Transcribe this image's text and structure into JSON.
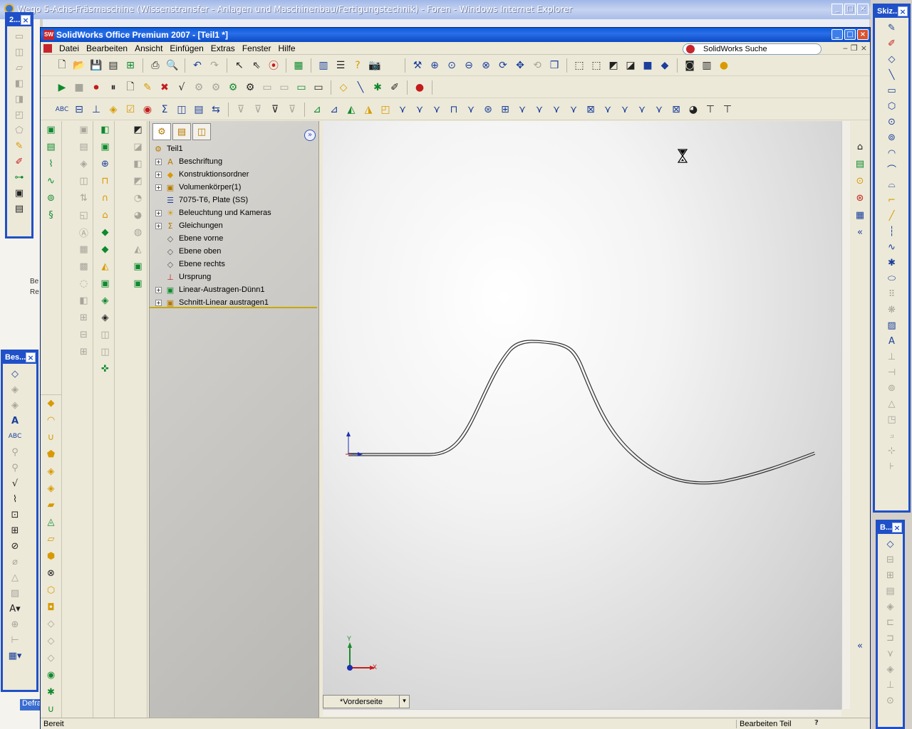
{
  "ie_window": {
    "title": "Wego 5-Achs-Fräsmaschine (Wissenstransfer - Anlagen und Maschinenbau/Fertigungstechnik) - Foren - Windows Internet Explorer"
  },
  "left_fragments": [
    "Be",
    "Re"
  ],
  "taskbar_fragment": "Defra",
  "float_toolbars": {
    "top_left_title": "2...",
    "annotations_title": "Bes...",
    "sketch_title": "Skiz...",
    "bottom_right_title": "B..."
  },
  "sw_window": {
    "title": "SolidWorks Office Premium 2007 - [Teil1 *]",
    "logo_text": "SW"
  },
  "menu": {
    "items": [
      "Datei",
      "Bearbeiten",
      "Ansicht",
      "Einfügen",
      "Extras",
      "Fenster",
      "Hilfe"
    ]
  },
  "search": {
    "label": "SolidWorks Suche"
  },
  "feature_tree": {
    "root": "Teil1",
    "items": [
      {
        "label": "Beschriftung",
        "expandable": true,
        "icon": "annotation-icon"
      },
      {
        "label": "Konstruktionsordner",
        "expandable": true,
        "icon": "design-folder-icon"
      },
      {
        "label": "Volumenkörper(1)",
        "expandable": true,
        "icon": "solid-bodies-icon"
      },
      {
        "label": "7075-T6, Plate (SS)",
        "expandable": false,
        "icon": "material-icon"
      },
      {
        "label": "Beleuchtung und Kameras",
        "expandable": true,
        "icon": "lights-icon"
      },
      {
        "label": "Gleichungen",
        "expandable": true,
        "icon": "equations-icon"
      },
      {
        "label": "Ebene vorne",
        "expandable": false,
        "icon": "plane-icon"
      },
      {
        "label": "Ebene oben",
        "expandable": false,
        "icon": "plane-icon"
      },
      {
        "label": "Ebene rechts",
        "expandable": false,
        "icon": "plane-icon"
      },
      {
        "label": "Ursprung",
        "expandable": false,
        "icon": "origin-icon"
      },
      {
        "label": "Linear-Austragen-Dünn1",
        "expandable": true,
        "icon": "extrude-icon"
      },
      {
        "label": "Schnitt-Linear austragen1",
        "expandable": true,
        "icon": "cut-extrude-icon"
      }
    ]
  },
  "viewport": {
    "view_name": "*Vorderseite",
    "triad_x": "X",
    "triad_y": "Y"
  },
  "status": {
    "left": "Bereit",
    "right": "Bearbeiten Teil",
    "help": "?"
  },
  "colors": {
    "title_blue": "#0a5bd8",
    "frame_blue": "#1f50c8",
    "sw_red": "#c6262b",
    "rollback_bar": "#c8a800"
  }
}
